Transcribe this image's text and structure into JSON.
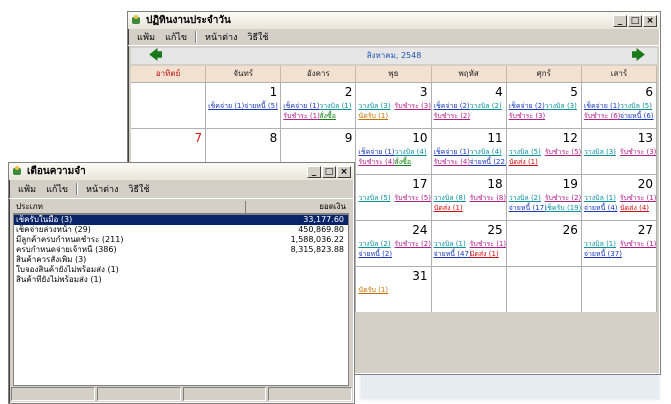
{
  "calendar": {
    "title": "ปฏิทินงานประจำวัน",
    "menu": [
      "แฟ้ม",
      "แก้ไข",
      "หน้าต่าง",
      "วิธีใช้"
    ],
    "month": "สิงหาคม, 2548",
    "days": [
      "อาทิตย์",
      "จันทร์",
      "อังคาร",
      "พุธ",
      "พฤหัส",
      "ศุกร์",
      "เสาร์"
    ],
    "weeks": [
      [
        {
          "n": ""
        },
        {
          "n": "1",
          "ev": [
            {
              "t": "เช็คจ่าย (1)",
              "c": "blue"
            },
            {
              "t": "จ่ายหนี้ (5)",
              "c": "blue"
            }
          ]
        },
        {
          "n": "2",
          "ev": [
            {
              "t": "เช็คจ่าย (1)",
              "c": "blue"
            },
            {
              "t": "วางบิล (1)",
              "c": "teal"
            },
            {
              "t": "รับชำระ (1)",
              "c": "mag"
            },
            {
              "t": "สั่งซื้อ",
              "c": "grn"
            }
          ]
        },
        {
          "n": "3",
          "ev": [
            {
              "t": "วางบิล (3)",
              "c": "teal"
            },
            {
              "t": "รับชำระ (3)",
              "c": "mag"
            },
            {
              "t": "นัดรับ (1)",
              "c": "orn"
            }
          ]
        },
        {
          "n": "4",
          "ev": [
            {
              "t": "เช็คจ่าย (2)",
              "c": "blue"
            },
            {
              "t": "วางบิล (2)",
              "c": "teal"
            },
            {
              "t": "รับชำระ (2)",
              "c": "mag"
            }
          ]
        },
        {
          "n": "5",
          "ev": [
            {
              "t": "เช็คจ่าย (2)",
              "c": "blue"
            },
            {
              "t": "วางบิล (3)",
              "c": "teal"
            },
            {
              "t": "รับชำระ (3)",
              "c": "mag"
            }
          ]
        },
        {
          "n": "6",
          "ev": [
            {
              "t": "เช็คจ่าย (1)",
              "c": "blue"
            },
            {
              "t": "วางบิล (5)",
              "c": "teal"
            },
            {
              "t": "รับชำระ (6)",
              "c": "mag"
            },
            {
              "t": "จ่ายหนี้ (6)",
              "c": "blue"
            }
          ]
        }
      ],
      [
        {
          "n": "7",
          "red": true
        },
        {
          "n": "8"
        },
        {
          "n": "9"
        },
        {
          "n": "10",
          "ev": [
            {
              "t": "เช็คจ่าย (1)",
              "c": "blue"
            },
            {
              "t": "วางบิล (4)",
              "c": "teal"
            },
            {
              "t": "รับชำระ (4)",
              "c": "mag"
            },
            {
              "t": "สั่งซื้อ",
              "c": "grn"
            }
          ]
        },
        {
          "n": "11",
          "ev": [
            {
              "t": "เช็คจ่าย (1)",
              "c": "blue"
            },
            {
              "t": "วางบิล (4)",
              "c": "teal"
            },
            {
              "t": "รับชำระ (4)",
              "c": "mag"
            },
            {
              "t": "จ่ายหนี้ (22)",
              "c": "blue"
            }
          ]
        },
        {
          "n": "12",
          "ev": [
            {
              "t": "วางบิล (5)",
              "c": "teal"
            },
            {
              "t": "รับชำระ (5)",
              "c": "mag"
            },
            {
              "t": "นัดส่ง (1)",
              "c": "red"
            }
          ]
        },
        {
          "n": "13",
          "ev": [
            {
              "t": "วางบิล (3)",
              "c": "teal"
            },
            {
              "t": "รับชำระ (3)",
              "c": "mag"
            }
          ]
        }
      ],
      [
        {
          "n": ""
        },
        {
          "n": ""
        },
        {
          "n": ""
        },
        {
          "n": "17",
          "ev": [
            {
              "t": "วางบิล (5)",
              "c": "teal"
            },
            {
              "t": "รับชำระ (5)",
              "c": "mag"
            }
          ]
        },
        {
          "n": "18",
          "ev": [
            {
              "t": "วางบิล (8)",
              "c": "teal"
            },
            {
              "t": "รับชำระ (8)",
              "c": "mag"
            },
            {
              "t": "นัดส่ง (1)",
              "c": "red"
            }
          ]
        },
        {
          "n": "19",
          "ev": [
            {
              "t": "วางบิล (2)",
              "c": "teal"
            },
            {
              "t": "รับชำระ (2)",
              "c": "mag"
            },
            {
              "t": "จ่ายหนี้ (17)",
              "c": "blue"
            },
            {
              "t": "เช็ครับ (19)",
              "c": "teal"
            }
          ]
        },
        {
          "n": "20",
          "ev": [
            {
              "t": "วางบิล (1)",
              "c": "teal"
            },
            {
              "t": "รับชำระ (1)",
              "c": "mag"
            },
            {
              "t": "จ่ายหนี้ (4)",
              "c": "blue"
            },
            {
              "t": "นัดส่ง (4)",
              "c": "red"
            }
          ]
        }
      ],
      [
        {
          "n": ""
        },
        {
          "n": ""
        },
        {
          "n": ""
        },
        {
          "n": "24",
          "ev": [
            {
              "t": "วางบิล (2)",
              "c": "teal"
            },
            {
              "t": "รับชำระ (2)",
              "c": "mag"
            },
            {
              "t": "จ่ายหนี้ (2)",
              "c": "blue"
            }
          ]
        },
        {
          "n": "25",
          "ev": [
            {
              "t": "วางบิล (1)",
              "c": "teal"
            },
            {
              "t": "รับชำระ (1)",
              "c": "mag"
            },
            {
              "t": "จ่ายหนี้ (47)",
              "c": "blue"
            },
            {
              "t": "นัดส่ง (1)",
              "c": "red"
            }
          ]
        },
        {
          "n": "26"
        },
        {
          "n": "27",
          "ev": [
            {
              "t": "วางบิล (1)",
              "c": "teal"
            },
            {
              "t": "รับชำระ (1)",
              "c": "mag"
            },
            {
              "t": "จ่ายหนี้ (37)",
              "c": "blue"
            }
          ]
        }
      ],
      [
        {
          "n": ""
        },
        {
          "n": ""
        },
        {
          "n": ""
        },
        {
          "n": "31",
          "ev": [
            {
              "t": "นัดรับ (1)",
              "c": "orn"
            }
          ]
        },
        {
          "n": ""
        },
        {
          "n": ""
        },
        {
          "n": ""
        }
      ]
    ]
  },
  "reminder": {
    "title": "เตือนความจำ",
    "menu": [
      "แฟ้ม",
      "แก้ไข",
      "หน้าต่าง",
      "วิธีใช้"
    ],
    "col_type": "ประเภท",
    "col_amount": "ยอดเงิน",
    "rows": [
      {
        "label": "เช็ครับในมือ (3)",
        "amount": "33,177.60",
        "selected": true
      },
      {
        "label": "เช็คจ่ายล่วงหน้า (29)",
        "amount": "450,869.80"
      },
      {
        "label": "มีลูกค้าครบกำหนดชำระ (211)",
        "amount": "1,588,036.22"
      },
      {
        "label": "ครบกำหนดจ่ายเจ้าหนี้ (386)",
        "amount": "8,315,823.88"
      },
      {
        "label": "สินค้าควรสั่งเพิ่ม (3)",
        "amount": ""
      },
      {
        "label": "ใบจองสินค้ายังไม่พร้อมส่ง (1)",
        "amount": ""
      },
      {
        "label": "สินค้าที่ยังไม่พร้อมส่ง (1)",
        "amount": ""
      }
    ]
  }
}
